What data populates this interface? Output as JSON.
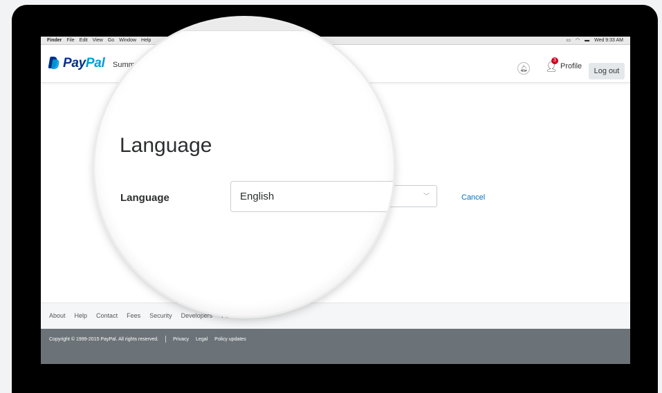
{
  "menubar": {
    "items": [
      "Finder",
      "File",
      "Edit",
      "View",
      "Go",
      "Window",
      "Help"
    ],
    "clock": "Wed 9:33 AM"
  },
  "header": {
    "brand_pay": "Pay",
    "brand_pal": "Pal",
    "nav_summary": "Summary",
    "notification_count": "3",
    "profile_label": "Profile",
    "logout_label": "Log out"
  },
  "main": {
    "heading": "Language",
    "field_label": "Language",
    "select_value": "English",
    "cancel_label": "Cancel"
  },
  "footer": {
    "links": [
      "About",
      "Help",
      "Contact",
      "Fees",
      "Security",
      "Developers",
      "Partners"
    ],
    "copyright": "Copyright © 1999-2015 PayPal. All rights reserved.",
    "legal_links": [
      "Privacy",
      "Legal",
      "Policy updates"
    ]
  }
}
